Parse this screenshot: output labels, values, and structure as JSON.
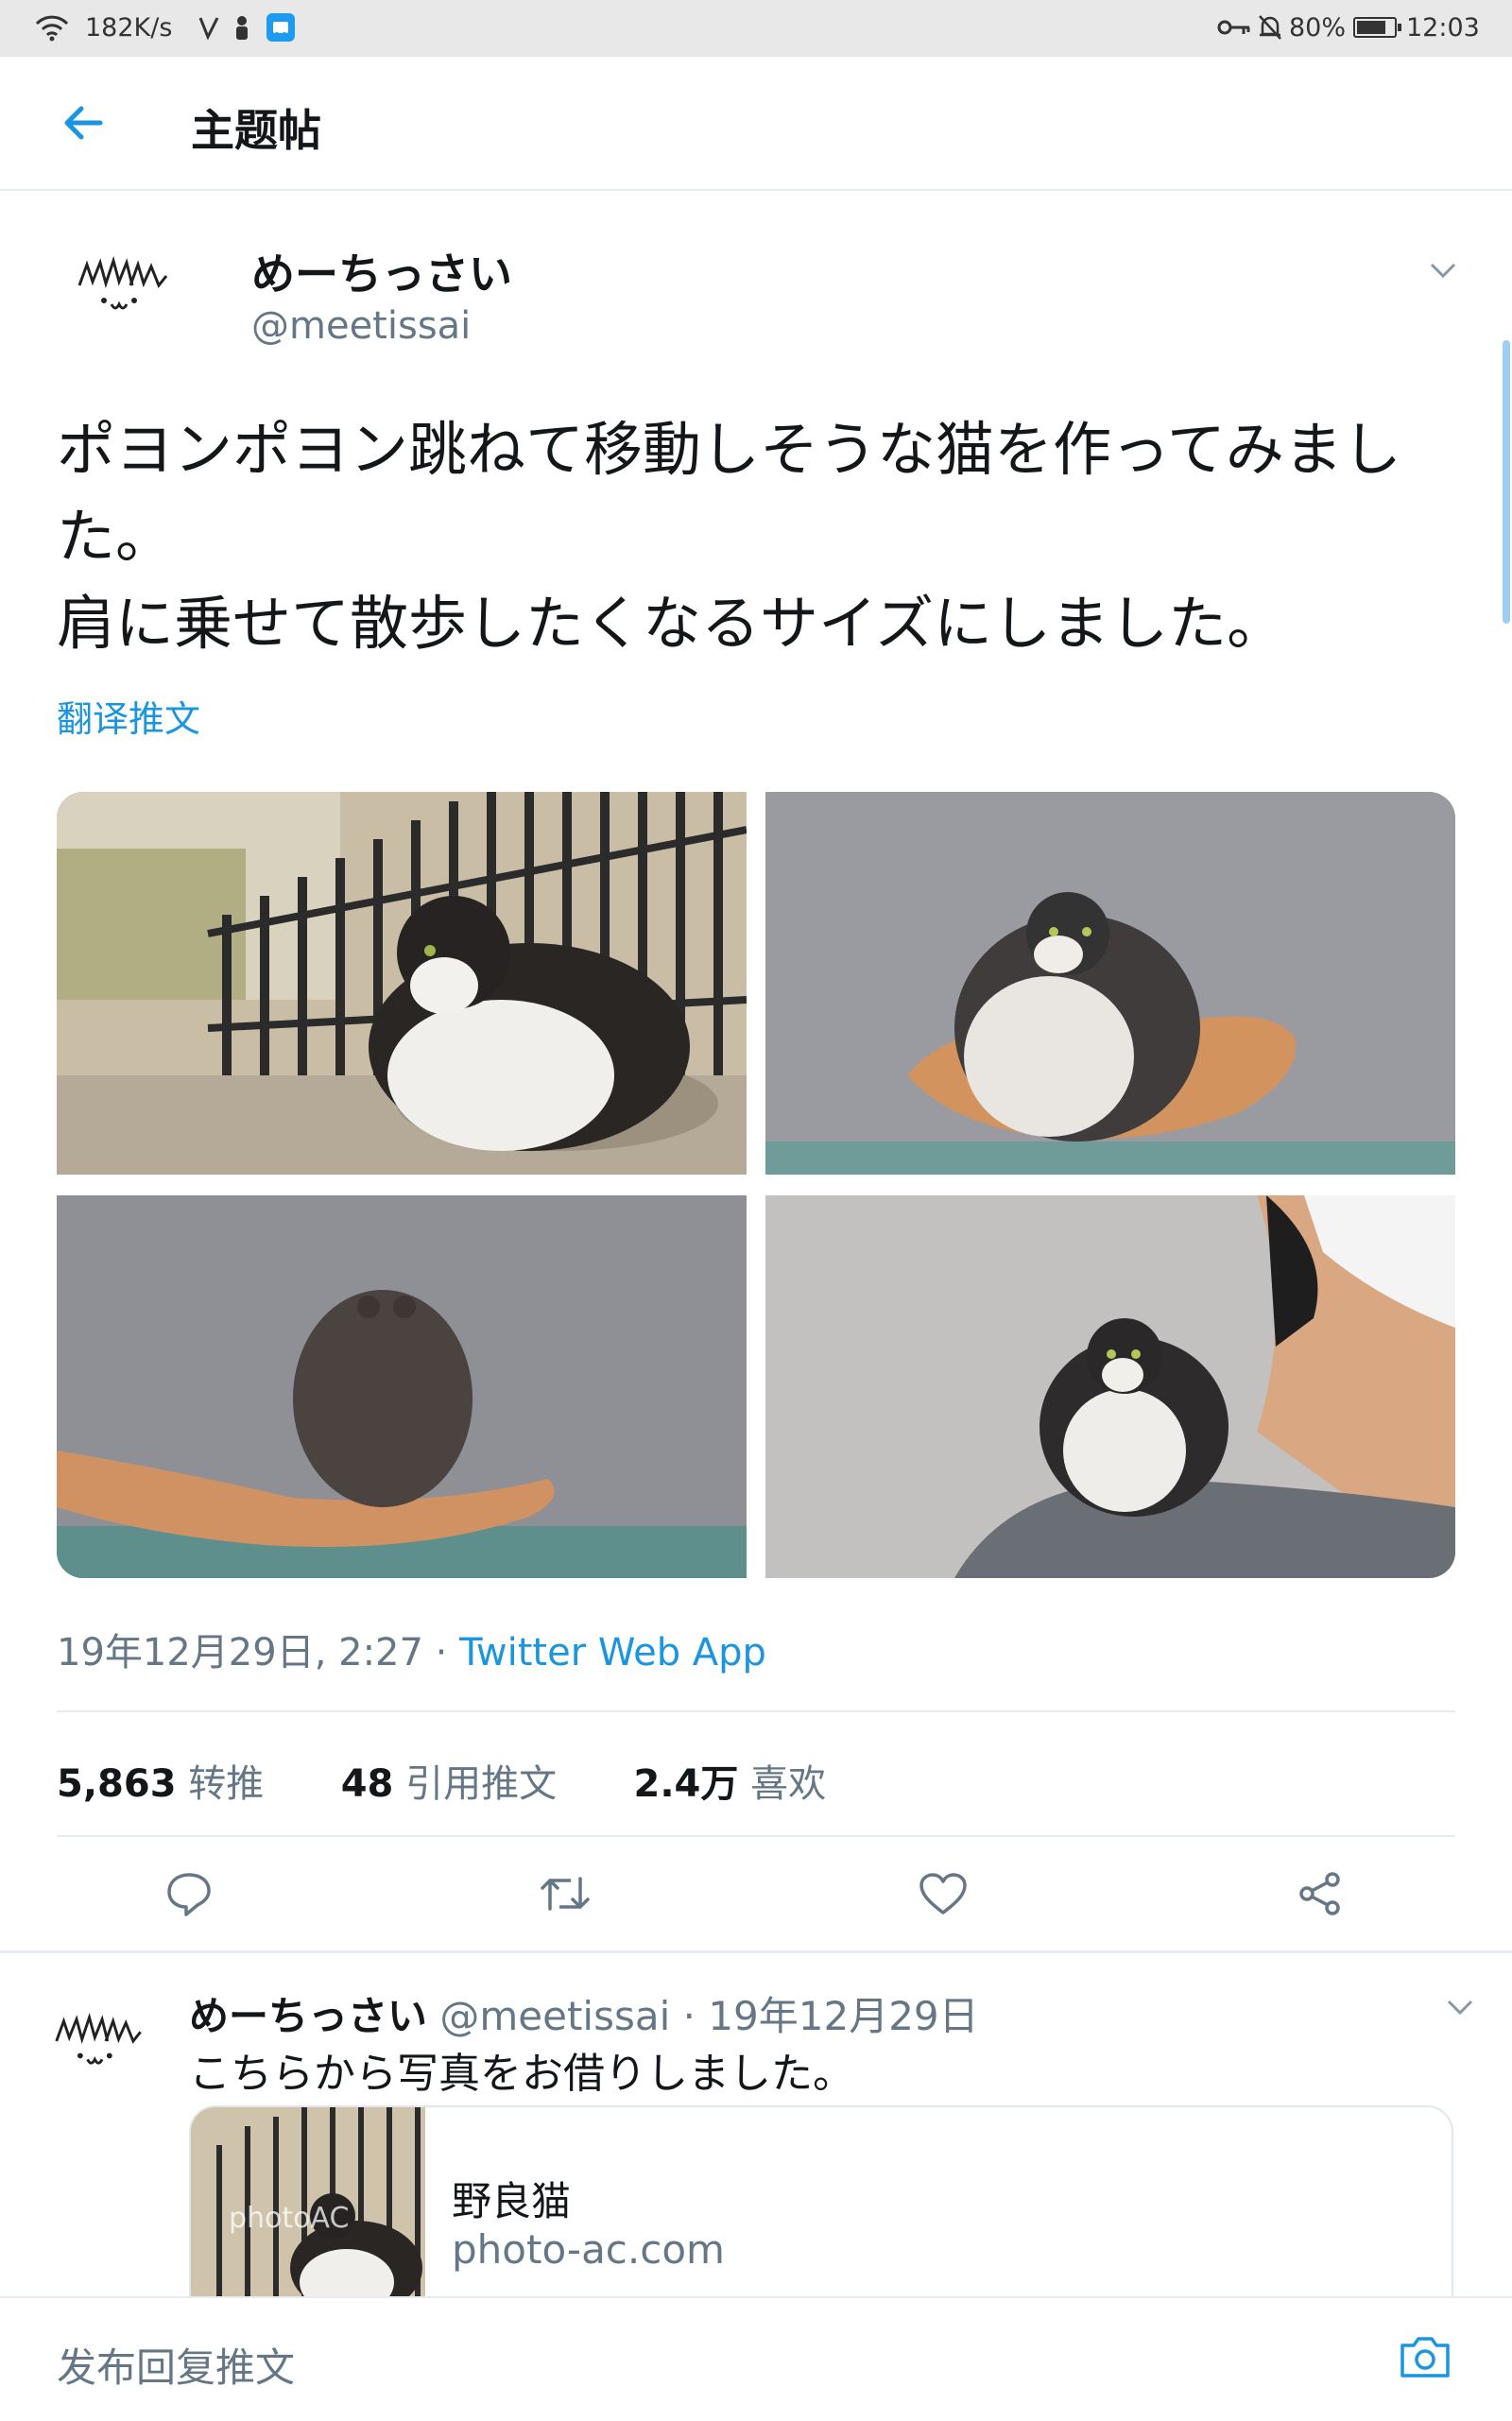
{
  "status_bar": {
    "net_speed": "182K/s",
    "battery_pct": "80%",
    "time": "12:03",
    "battery_level": 0.8
  },
  "header": {
    "title": "主题帖"
  },
  "tweet": {
    "display_name": "めーちっさい",
    "handle": "@meetissai",
    "text": "ポヨンポヨン跳ねて移動しそうな猫を作ってみました。\n肩に乗せて散歩したくなるサイズにしました。",
    "translate_label": "翻译推文",
    "timestamp": "19年12月29日, 2:27 · ",
    "source": "Twitter Web App",
    "stats": {
      "retweets_count": "5,863",
      "retweets_label": "转推",
      "quotes_count": "48",
      "quotes_label": "引用推文",
      "likes_count": "2.4万",
      "likes_label": "喜欢"
    }
  },
  "reply": {
    "display_name": "めーちっさい",
    "meta": "@meetissai · 19年12月29日",
    "text": "こちらから写真をお借りしました。",
    "card": {
      "title": "野良猫",
      "domain": "photo-ac.com",
      "watermark": "photoAC"
    }
  },
  "composer": {
    "placeholder": "发布回复推文"
  },
  "colors": {
    "accent": "#1b95e0",
    "muted": "#657786",
    "text": "#14171a"
  }
}
